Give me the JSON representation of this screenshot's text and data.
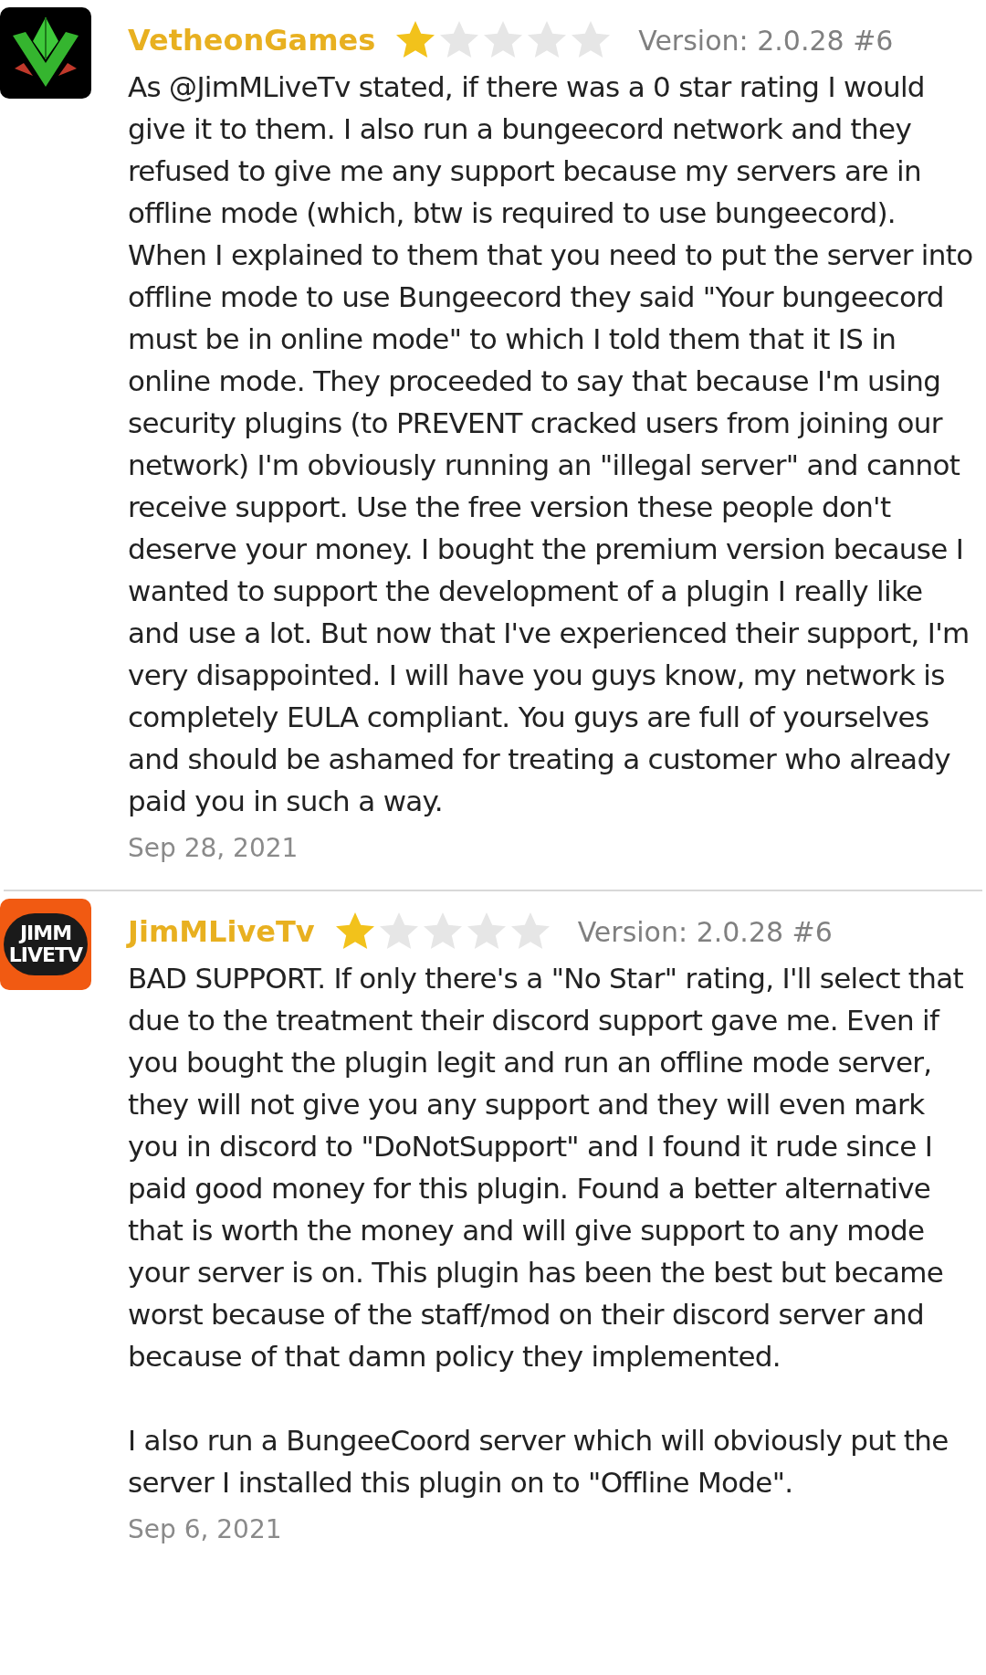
{
  "reviews": [
    {
      "author": "VetheonGames",
      "avatar": {
        "kind": "v-logo"
      },
      "stars": 1,
      "version": "Version: 2.0.28 #6",
      "paragraphs": [
        "As @JimMLiveTv stated, if there was a 0 star rating I would give it to them. I also run a bungeecord network and they refused to give me any support because my servers are in offline mode (which, btw is required to use bungeecord). When I explained to them that you need to put the server into offline mode to use Bungeecord they said \"Your bungeecord must be in online mode\" to which I told them that it IS in online mode. They proceeded to say that because I'm using security plugins (to PREVENT cracked users from joining our network) I'm obviously running an \"illegal server\" and cannot receive support. Use the free version these people don't deserve your money. I bought the premium version because I wanted to support the development of a plugin I really like and use a lot. But now that I've experienced their support, I'm very disappointed. I will have you guys know, my network is completely EULA compliant. You guys are full of yourselves and should be ashamed for treating a customer who already paid you in such a way."
      ],
      "date": "Sep 28, 2021"
    },
    {
      "author": "JimMLiveTv",
      "avatar": {
        "kind": "text-logo",
        "lines": [
          "JIMM",
          "LIVETV"
        ]
      },
      "stars": 1,
      "version": "Version: 2.0.28 #6",
      "paragraphs": [
        "BAD SUPPORT. If only there's a \"No Star\" rating, I'll select that due to the treatment their discord support gave me. Even if you bought the plugin legit and run an offline mode server, they will not give you any support and they will even mark you in discord to \"DoNotSupport\" and I found it rude since I paid good money for this plugin. Found a better alternative that is worth the money and will give support to any mode your server is on. This plugin has been the best but became worst because of the staff/mod on their discord server and because of that damn policy they implemented.",
        "I also run a BungeeCoord server which will obviously put the server I installed this plugin on to \"Offline Mode\"."
      ],
      "date": "Sep 6, 2021"
    }
  ]
}
